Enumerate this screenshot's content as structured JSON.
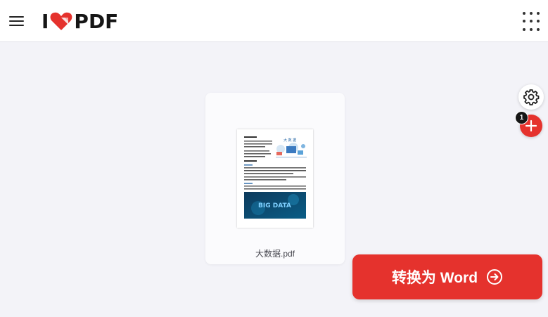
{
  "header": {
    "logo": {
      "left": "I",
      "right": "PDF",
      "brand_color": "#e5322d"
    },
    "menu_icon": "hamburger-menu-icon",
    "apps_icon": "apps-grid-icon"
  },
  "files": [
    {
      "name": "大数据.pdf",
      "thumbnail_banner": "BIG DATA",
      "thumbnail_heading": "大 数 据"
    }
  ],
  "sidebar_controls": {
    "settings_icon": "gear-icon",
    "add_icon": "plus-icon",
    "file_count": "1"
  },
  "action": {
    "convert_label": "转换为 Word",
    "convert_icon": "arrow-right-circle-icon",
    "accent": "#e5322d"
  }
}
